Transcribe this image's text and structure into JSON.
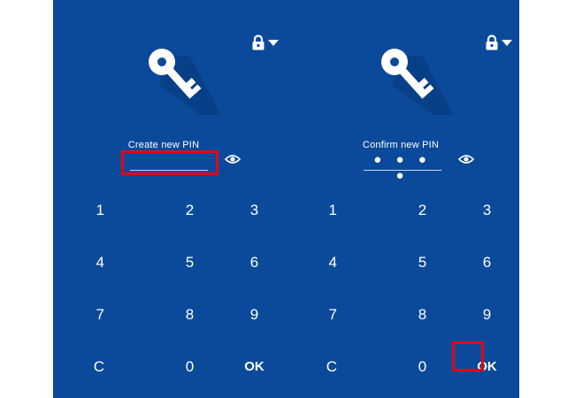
{
  "screens": [
    {
      "id": "create",
      "label": "Create new PIN",
      "pin_value": "",
      "keys": [
        "1",
        "2",
        "3",
        "4",
        "5",
        "6",
        "7",
        "8",
        "9",
        "C",
        "0",
        "OK"
      ]
    },
    {
      "id": "confirm",
      "label": "Confirm new PIN",
      "pin_value": "● ● ● ●",
      "keys": [
        "1",
        "2",
        "3",
        "4",
        "5",
        "6",
        "7",
        "8",
        "9",
        "C",
        "0",
        "OK"
      ]
    }
  ],
  "colors": {
    "background": "#0b4a9a",
    "highlight": "#e30613",
    "text": "#ffffff"
  },
  "icons": {
    "key": "key-icon",
    "lock": "lock-icon",
    "dropdown": "caret-down-icon",
    "visibility": "eye-icon"
  }
}
